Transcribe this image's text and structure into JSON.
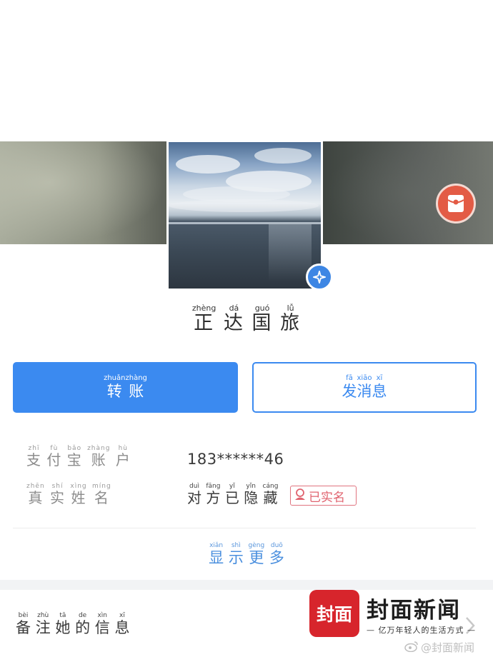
{
  "profile": {
    "name": "正达国旅",
    "name_pinyin": [
      "zhèng",
      "dá",
      "guó",
      "lǚ"
    ],
    "name_chars": [
      "正",
      "达",
      "国",
      "旅"
    ],
    "verified_icon": "verified-star-icon",
    "red_packet_icon": "red-packet-icon"
  },
  "actions": {
    "transfer": {
      "chars": [
        "转",
        "账"
      ],
      "pinyin": [
        "zhuǎn",
        "zhàng"
      ],
      "label": "转账"
    },
    "message": {
      "chars": [
        "发",
        "消",
        "息"
      ],
      "pinyin": [
        "fā",
        "xiāo",
        "xī"
      ],
      "label": "发消息"
    }
  },
  "info": {
    "alipay_label": {
      "chars": [
        "支",
        "付",
        "宝",
        "账",
        "户"
      ],
      "pinyin": [
        "zhī",
        "fù",
        "bǎo",
        "zhàng",
        "hù"
      ]
    },
    "alipay_value": "183******46",
    "realname_label": {
      "chars": [
        "真",
        "实",
        "姓",
        "名"
      ],
      "pinyin": [
        "zhēn",
        "shí",
        "xìng",
        "míng"
      ]
    },
    "realname_value": {
      "chars": [
        "对",
        "方",
        "已",
        "隐",
        "藏"
      ],
      "pinyin": [
        "duì",
        "fāng",
        "yǐ",
        "yǐn",
        "cáng"
      ]
    },
    "verified_badge": "已实名"
  },
  "show_more": {
    "chars": [
      "显",
      "示",
      "更",
      "多"
    ],
    "pinyin": [
      "xiǎn",
      "shì",
      "gèng",
      "duō"
    ]
  },
  "remark": {
    "chars": [
      "备",
      "注",
      "她",
      "的",
      "信",
      "息"
    ],
    "pinyin": [
      "bèi",
      "zhù",
      "tā",
      "de",
      "xìn",
      "xī"
    ]
  },
  "watermark": {
    "logo_text": "封面",
    "title": "封面新闻",
    "slogan": "— 亿万年轻人的生活方式 —",
    "weibo_handle": "@封面新闻"
  },
  "colors": {
    "accent": "#3b8af0",
    "badge": "#e0636f",
    "watermark_red": "#d7252c"
  }
}
